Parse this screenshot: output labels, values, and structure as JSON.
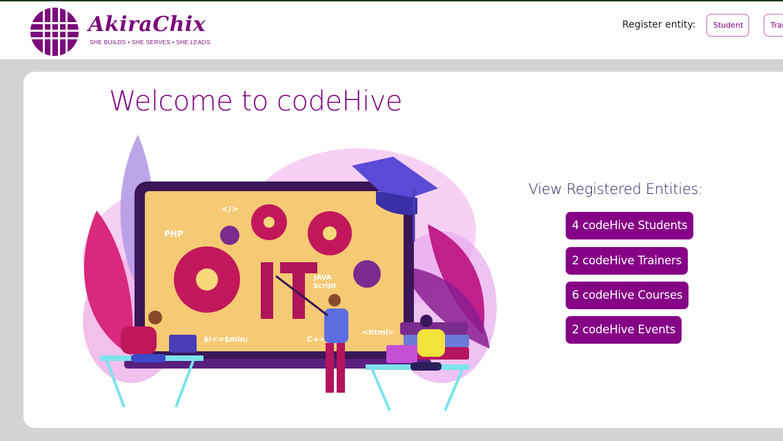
{
  "brand": {
    "name": "AkiraChix",
    "tagline": "SHE BUILDS • SHE SERVES • SHE LEADS"
  },
  "header": {
    "register_label": "Register entity:",
    "buttons": [
      {
        "label": "Student"
      },
      {
        "label": "Trainer"
      }
    ]
  },
  "main": {
    "title": "Welcome to codeHive",
    "illustration": {
      "labels": [
        "PHP",
        "</>",
        "IT",
        "JAVA Script",
        "$i<=$min;",
        "C++",
        "<html>"
      ]
    },
    "entities_title": "View Registered Entities:",
    "entities": [
      {
        "label": "4 codeHive Students"
      },
      {
        "label": "2 codeHive Trainers"
      },
      {
        "label": "6 codeHive Courses"
      },
      {
        "label": "2 codeHive Events"
      }
    ]
  },
  "colors": {
    "brand": "#800080",
    "button_bg": "#850085",
    "page_bg": "#d5d2d2"
  }
}
